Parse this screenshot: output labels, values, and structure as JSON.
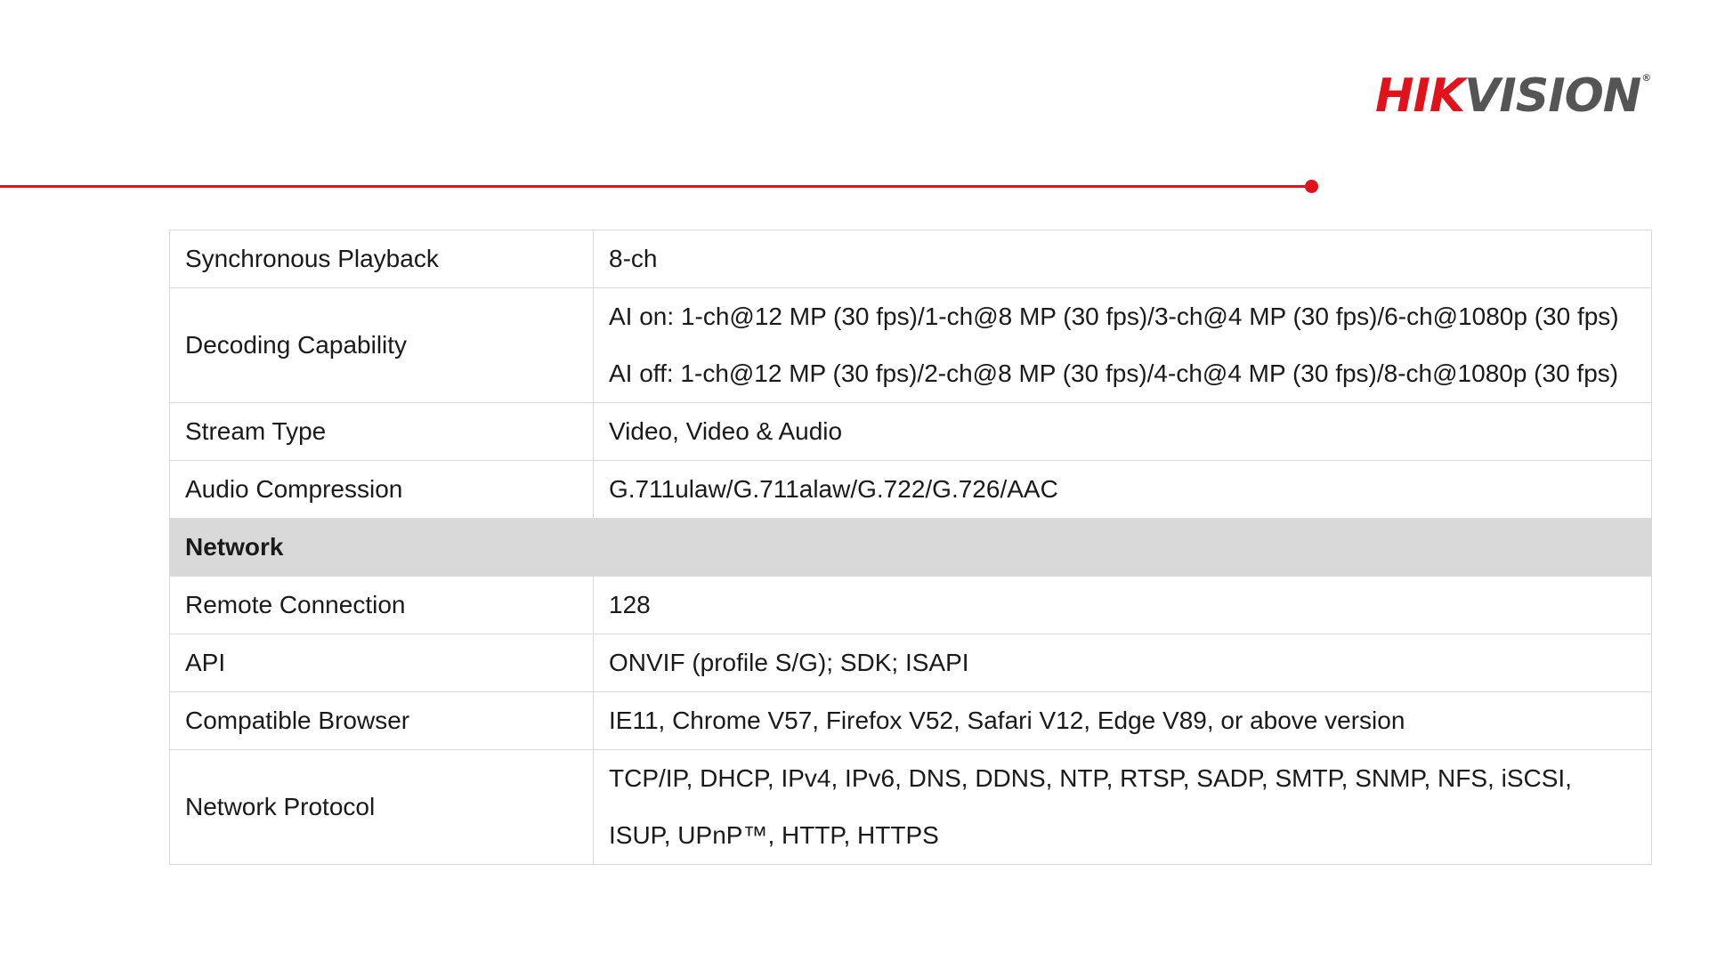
{
  "header": {
    "logo_hik": "HIK",
    "logo_vision": "VISION",
    "logo_mark": "®",
    "accent_color": "#e0121a"
  },
  "rows": [
    {
      "label": "Synchronous Playback",
      "values": [
        "8-ch"
      ]
    },
    {
      "label": "Decoding Capability",
      "values": [
        "AI on: 1-ch@12 MP (30 fps)/1-ch@8 MP (30 fps)/3-ch@4 MP (30 fps)/6-ch@1080p (30 fps)",
        "AI off: 1-ch@12 MP (30 fps)/2-ch@8 MP (30 fps)/4-ch@4 MP (30 fps)/8-ch@1080p (30 fps)"
      ]
    },
    {
      "label": "Stream Type",
      "values": [
        "Video, Video & Audio"
      ]
    },
    {
      "label": "Audio Compression",
      "values": [
        "G.711ulaw/G.711alaw/G.722/G.726/AAC"
      ]
    },
    {
      "section": "Network"
    },
    {
      "label": "Remote Connection",
      "values": [
        "128"
      ]
    },
    {
      "label": "API",
      "values": [
        "ONVIF (profile S/G); SDK; ISAPI"
      ]
    },
    {
      "label": "Compatible Browser",
      "values": [
        "IE11, Chrome V57, Firefox V52, Safari V12, Edge V89, or above version"
      ]
    },
    {
      "label": "Network Protocol",
      "values": [
        "TCP/IP, DHCP, IPv4, IPv6, DNS, DDNS, NTP, RTSP, SADP, SMTP, SNMP, NFS, iSCSI, ISUP, UPnP™, HTTP, HTTPS"
      ]
    }
  ]
}
